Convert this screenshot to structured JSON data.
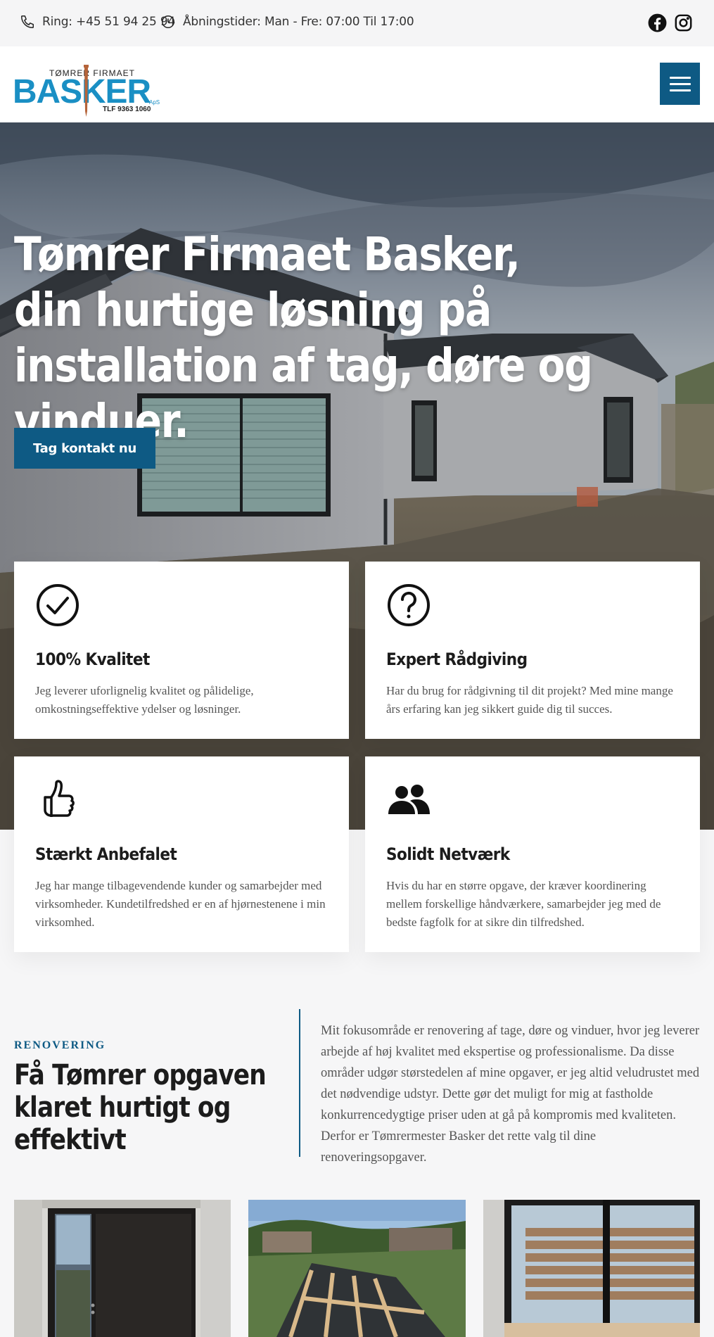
{
  "topbar": {
    "phone_text": "Ring: +45 51 94 25 94",
    "hours_text": "Åbningstider: Man - Fre: 07:00 Til 17:00",
    "social_icons": [
      "facebook-icon",
      "instagram-icon"
    ]
  },
  "header": {
    "logo": {
      "top_text": "TØMRER FIRMAET",
      "brand_text": "BASKER",
      "suffix_text": "ApS",
      "phone_text": "TLF 9363 1060"
    },
    "menu_icon": "hamburger-icon"
  },
  "hero": {
    "title": "Tømrer Firmaet Basker, din hurtige løsning på installation af tag, døre og vinduer.",
    "cta_label": "Tag kontakt nu"
  },
  "features": [
    {
      "icon": "check-circle-icon",
      "title": "100% Kvalitet",
      "text": "Jeg leverer uforlignelig kvalitet og pålidelige, omkostningseffektive ydelser og løsninger."
    },
    {
      "icon": "question-circle-icon",
      "title": "Expert Rådgiving",
      "text": "Har du brug for rådgivning til dit projekt? Med mine mange års erfaring kan jeg sikkert guide dig til succes."
    },
    {
      "icon": "thumbs-up-icon",
      "title": "Stærkt Anbefalet",
      "text": "Jeg har mange tilbagevendende kunder og samarbejder med virksomheder. Kundetilfredshed er en af hjørnestenene i min virksomhed."
    },
    {
      "icon": "people-icon",
      "title": "Solidt Netværk",
      "text": "Hvis du har en større opgave, der kræver koordinering mellem forskellige håndværkere, samarbejder jeg med de bedste fagfolk for at sikre din tilfredshed."
    }
  ],
  "renovation": {
    "kicker": "RENOVERING",
    "title": "Få Tømrer opgaven klaret hurtigt og effektivt",
    "text": "Mit fokusområde er renovering af tage, døre og vinduer, hvor jeg leverer arbejde af høj kvalitet med ekspertise og professionalisme. Da disse områder udgør størstedelen af mine opgaver, er jeg altid veludrustet med det nødvendige udstyr. Dette gør det muligt for mig at fastholde konkurrencedygtige priser uden at gå på kompromis med kvaliteten. Derfor er Tømrermester Basker det rette valg til dine renoveringsopgaver."
  },
  "colors": {
    "brand_blue": "#0e5a84",
    "logo_blue": "#1a8fc4",
    "nail_copper": "#b5643a",
    "page_bg": "#f6f6f7"
  }
}
